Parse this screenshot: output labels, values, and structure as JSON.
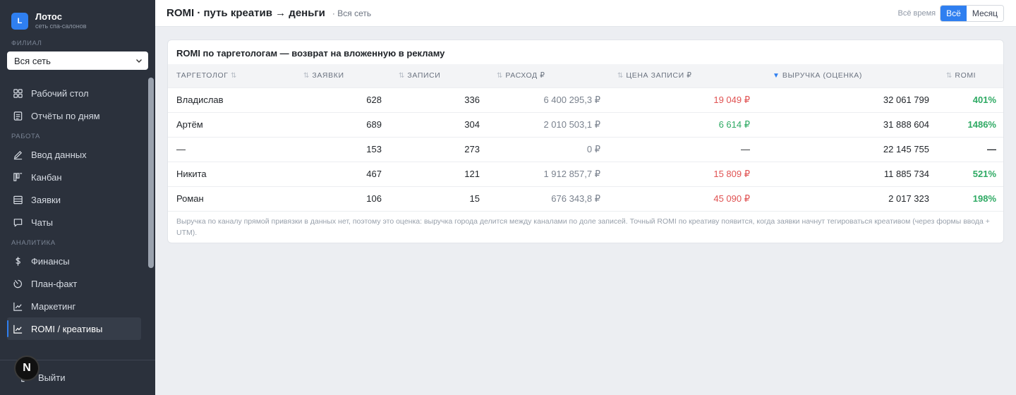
{
  "brand": {
    "logo_letter": "L",
    "title": "Лотос",
    "subtitle": "сеть спа-салонов"
  },
  "sidebar": {
    "branch_label": "ФИЛИАЛ",
    "branch_value": "Вся сеть",
    "items_top": [
      {
        "label": "Рабочий стол",
        "icon": "monitor-icon"
      },
      {
        "label": "Отчёты по дням",
        "icon": "calendar-icon"
      }
    ],
    "section_work": "РАБОТА",
    "items_work": [
      {
        "label": "Ввод данных",
        "icon": "pencil-icon"
      },
      {
        "label": "Канбан",
        "icon": "kanban-icon"
      },
      {
        "label": "Заявки",
        "icon": "list-icon"
      },
      {
        "label": "Чаты",
        "icon": "chat-icon"
      }
    ],
    "section_analytics": "АНАЛИТИКА",
    "items_analytics": [
      {
        "label": "Финансы",
        "icon": "dollar-icon"
      },
      {
        "label": "План-факт",
        "icon": "gauge-icon"
      },
      {
        "label": "Маркетинг",
        "icon": "line-chart-icon"
      },
      {
        "label": "ROMI / креативы",
        "icon": "line-chart-icon",
        "active": true
      }
    ],
    "exit_label": "Выйти",
    "badge": "N"
  },
  "header": {
    "title": "ROMI · путь креатив → деньги",
    "scope": "· Вся сеть",
    "period_label": "Всё время",
    "period_options": [
      "Всё",
      "Месяц"
    ],
    "period_selected": "Всё"
  },
  "card": {
    "title": "ROMI по таргетологам — возврат на вложенную в рекламу",
    "columns": [
      "ТАРГЕТОЛОГ",
      "ЗАЯВКИ",
      "ЗАПИСИ",
      "РАСХОД ₽",
      "ЦЕНА ЗАПИСИ ₽",
      "ВЫРУЧКА (ОЦЕНКА)",
      "ROMI"
    ],
    "sorted_column": "ВЫРУЧКА (ОЦЕНКА)",
    "rows": [
      {
        "name": "Владислав",
        "leads": "628",
        "records": "336",
        "spend": "6 400 295,3 ₽",
        "cost": "19 049 ₽",
        "cost_color": "#e05252",
        "revenue": "32 061 799",
        "romi": "401%"
      },
      {
        "name": "Артём",
        "leads": "689",
        "records": "304",
        "spend": "2 010 503,1 ₽",
        "cost": "6 614 ₽",
        "cost_color": "#2faa64",
        "revenue": "31 888 604",
        "romi": "1486%"
      },
      {
        "name": "—",
        "leads": "153",
        "records": "273",
        "spend": "0 ₽",
        "cost": "—",
        "cost_color": "#1f2328",
        "revenue": "22 145 755",
        "romi": "—"
      },
      {
        "name": "Никита",
        "leads": "467",
        "records": "121",
        "spend": "1 912 857,7 ₽",
        "cost": "15 809 ₽",
        "cost_color": "#e05252",
        "revenue": "11 885 734",
        "romi": "521%"
      },
      {
        "name": "Роман",
        "leads": "106",
        "records": "15",
        "spend": "676 343,8 ₽",
        "cost": "45 090 ₽",
        "cost_color": "#e05252",
        "revenue": "2 017 323",
        "romi": "198%"
      }
    ],
    "note": "Выручка по каналу прямой привязки в данных нет, поэтому это оценка: выручка города делится между каналами по доле записей. Точный ROMI по креативу появится, когда заявки начнут тегироваться креативом (через формы ввода + UTM)."
  },
  "colors": {
    "accent": "#2f7ff0",
    "sidebar_bg": "#2b313c",
    "positive": "#2faa64",
    "negative": "#e05252"
  }
}
